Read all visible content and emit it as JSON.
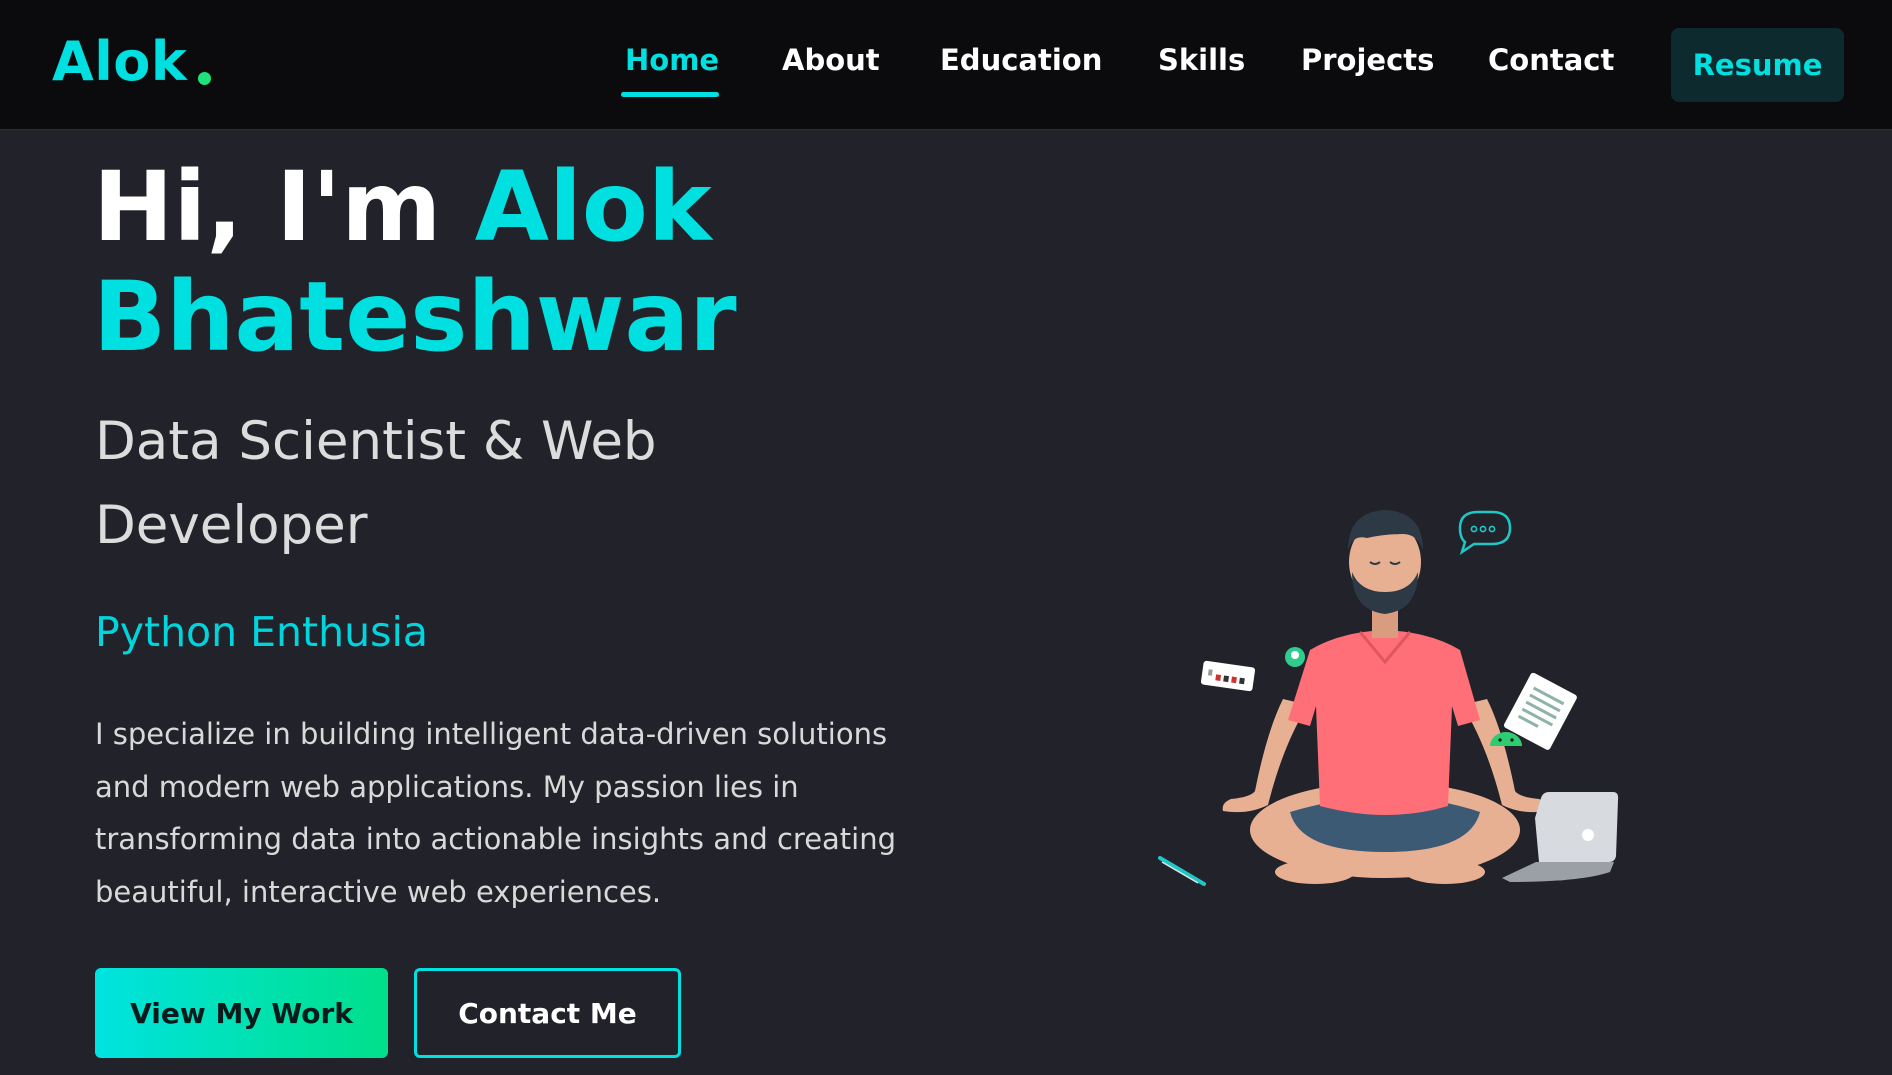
{
  "brand": {
    "logo_text": "Alok",
    "accent_color": "#00e0e0",
    "dot_color": "#1ee37a"
  },
  "nav": {
    "items": [
      {
        "label": "Home",
        "active": true
      },
      {
        "label": "About"
      },
      {
        "label": "Education"
      },
      {
        "label": "Skills"
      },
      {
        "label": "Projects"
      },
      {
        "label": "Contact"
      }
    ],
    "resume_label": "Resume"
  },
  "hero": {
    "greeting": "Hi, I'm",
    "first_name": "Alok",
    "last_name": "Bhateshwar",
    "subtitle": "Data Scientist & Web Developer",
    "typed_text": "Python Enthusia",
    "description": "I specialize in building intelligent data-driven solutions and modern web applications. My passion lies in transforming data into actionable insights and creating beautiful, interactive web experiences.",
    "primary_button": "View My Work",
    "secondary_button": "Contact Me"
  },
  "illustration": {
    "name": "meditating-developer-illustration",
    "shirt_color": "#ff6f77",
    "shorts_color": "#3d5a75"
  }
}
